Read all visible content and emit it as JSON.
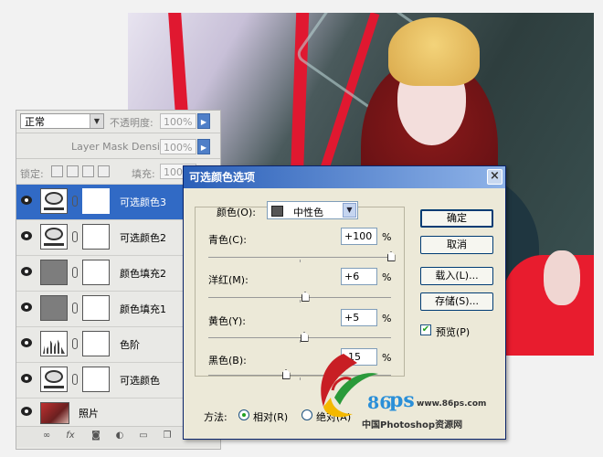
{
  "layers_panel": {
    "blend_mode": "正常",
    "opacity_label": "不透明度:",
    "opacity_value": "100%",
    "density_label": "Layer Mask Density",
    "density_value": "100%",
    "lock_label": "锁定:",
    "fill_label": "填充:",
    "fill_value": "100%",
    "layers": [
      {
        "name": "可选颜色3",
        "type": "selective-color",
        "selected": true
      },
      {
        "name": "可选颜色2",
        "type": "selective-color",
        "selected": false
      },
      {
        "name": "颜色填充2",
        "type": "color-fill",
        "selected": false
      },
      {
        "name": "颜色填充1",
        "type": "color-fill",
        "selected": false
      },
      {
        "name": "色阶",
        "type": "levels",
        "selected": false
      },
      {
        "name": "可选颜色",
        "type": "selective-color",
        "selected": false
      },
      {
        "name": "照片",
        "type": "photo",
        "selected": false
      }
    ],
    "bottom_icons": [
      "link-icon",
      "fx-icon",
      "mask-icon",
      "adjustment-icon",
      "group-icon",
      "new-layer-icon",
      "trash-icon"
    ]
  },
  "dialog": {
    "title": "可选颜色选项",
    "colors_label": "颜色(O):",
    "colors_value": "中性色",
    "colors_swatch": "#555555",
    "sliders": [
      {
        "label": "青色(C):",
        "value": "+100",
        "unit": "%",
        "level": 100
      },
      {
        "label": "洋红(M):",
        "value": "+6",
        "unit": "%",
        "level": 6
      },
      {
        "label": "黄色(Y):",
        "value": "+5",
        "unit": "%",
        "level": 5
      },
      {
        "label": "黑色(B):",
        "value": "-15",
        "unit": "%",
        "level": -15
      }
    ],
    "buttons": {
      "ok": "确定",
      "cancel": "取消",
      "load": "载入(L)...",
      "save": "存储(S)..."
    },
    "preview_label": "预览(P)",
    "preview_checked": true,
    "method_label": "方法:",
    "method_relative": "相对(R)",
    "method_absolute": "绝对(A)",
    "method_selected": "relative"
  },
  "watermark": {
    "brand_number": "86",
    "brand_letter": "ps",
    "url": "www.86ps.com",
    "tagline": "中国Photoshop资源网"
  },
  "colors": {
    "selection_blue": "#316ac5",
    "title_blue": "#2a5fb8",
    "dialog_bg": "#ece9d8",
    "accent_red": "#e01830"
  }
}
